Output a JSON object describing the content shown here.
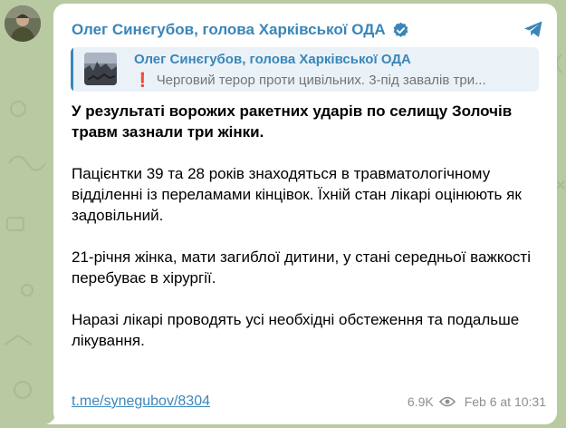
{
  "post": {
    "channel_name": "Олег Синєгубов, голова Харківської ОДА",
    "reply": {
      "title": "Олег Синєгубов, голова Харківської ОДА",
      "excerpt_mark": "❗",
      "excerpt": "Черговий терор проти цивільних. 3-під завалів три..."
    },
    "paragraphs": [
      "У результаті ворожих ракетних ударів по селищу Золочів травм зазнали три жінки.",
      "Пацієнтки 39 та 28 років знаходяться в травматологічному відділенні із переламами кінцівок. Їхній стан лікарі оцінюють як задовільний.",
      "21-річня жінка, мати загиблої дитини, у стані середньої важкості перебуває в хірургії.",
      "Наразі лікарі проводять усі необхідні обстеження та подальше лікування."
    ],
    "link": "t.me/synegubov/8304",
    "views": "6.9K",
    "date": "Feb 6 at 10:31"
  },
  "colors": {
    "background": "#b9c9a1",
    "accent": "#3a86b8",
    "reply_bg": "#eaf2f8",
    "meta": "#8a8f93"
  },
  "icons": {
    "verified": "verified-badge-icon",
    "views": "eye-icon",
    "share": "telegram-share-icon"
  }
}
